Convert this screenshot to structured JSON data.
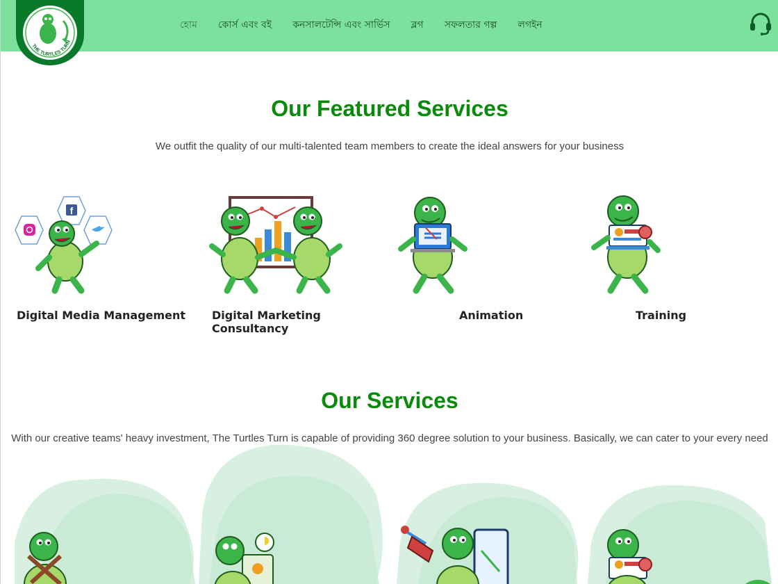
{
  "header": {
    "logo_text": "THE TURTLES TURN",
    "nav": [
      {
        "label": "হোম"
      },
      {
        "label": "কোর্স এবং বই"
      },
      {
        "label": "কনসালটেন্সি এবং সার্ভিস"
      },
      {
        "label": "ব্লগ"
      },
      {
        "label": "সফলতার গল্প"
      },
      {
        "label": "লগইন"
      }
    ],
    "support_icon": "headset-icon"
  },
  "featured": {
    "title": "Our Featured Services",
    "subtitle": "We outfit the quality of our multi-talented team members to create the ideal answers for your business",
    "items": [
      {
        "label": "Digital Media Management",
        "icon": "turtle-social-media-icon"
      },
      {
        "label": "Digital Marketing Consultancy",
        "icon": "turtle-marketing-chart-icon"
      },
      {
        "label": "Animation",
        "icon": "turtle-laptop-icon"
      },
      {
        "label": "Training",
        "icon": "turtle-training-icon"
      }
    ]
  },
  "services": {
    "title": "Our Services",
    "subtitle": "With our creative teams' heavy investment, The Turtles Turn is capable of providing 360 degree solution to your business. Basically, we can cater to your every need"
  },
  "colors": {
    "header_bg": "#7be19c",
    "heading_green": "#0a8a0a",
    "turtle_green": "#3bb44a",
    "blob": "#cdeede"
  }
}
